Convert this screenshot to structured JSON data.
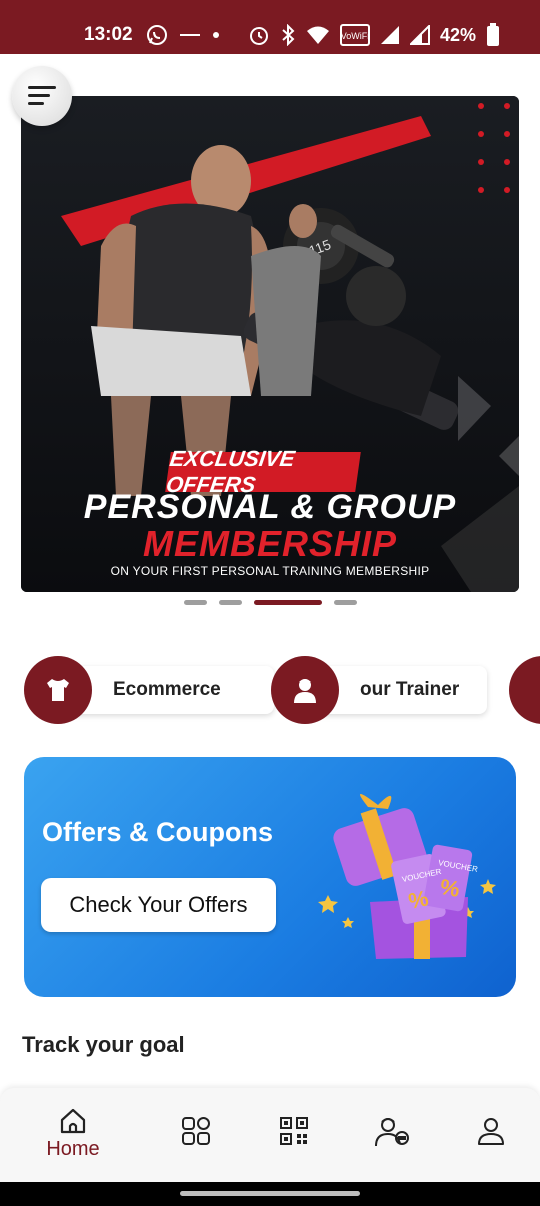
{
  "status_bar": {
    "time": "13:02",
    "battery": "42%",
    "icons": [
      "whatsapp-icon",
      "rapido-icon",
      "dot-icon",
      "alarm-icon",
      "bluetooth-icon",
      "wifi-icon",
      "vowifi-icon",
      "signal-icon",
      "signal-icon",
      "battery-icon"
    ]
  },
  "banner": {
    "badge": "EXCLUSIVE OFFERS",
    "title_line1": "PERSONAL & GROUP",
    "title_line2": "MEMBERSHIP",
    "subtitle": "ON YOUR FIRST PERSONAL TRAINING MEMBERSHIP",
    "dumbbell_label": "115",
    "slides": 4,
    "active_slide": 3
  },
  "quick_links": [
    {
      "label": "Ecommerce",
      "icon": "tshirt-icon"
    },
    {
      "label": "our Trainer",
      "icon": "trainer-icon"
    }
  ],
  "offers": {
    "title": "Offers & Coupons",
    "button": "Check Your Offers",
    "voucher_text": "VOUCHER"
  },
  "section": {
    "title": "Track your goal"
  },
  "nav": {
    "items": [
      {
        "label": "Home",
        "icon": "home-icon",
        "active": true
      },
      {
        "label": "",
        "icon": "apps-icon"
      },
      {
        "label": "",
        "icon": "qr-code-icon"
      },
      {
        "label": "",
        "icon": "trainer-icon"
      },
      {
        "label": "",
        "icon": "profile-icon"
      }
    ]
  },
  "colors": {
    "brand": "#7b1a22",
    "offers_blue": "#1b7de2",
    "banner_red": "#d21b25"
  }
}
